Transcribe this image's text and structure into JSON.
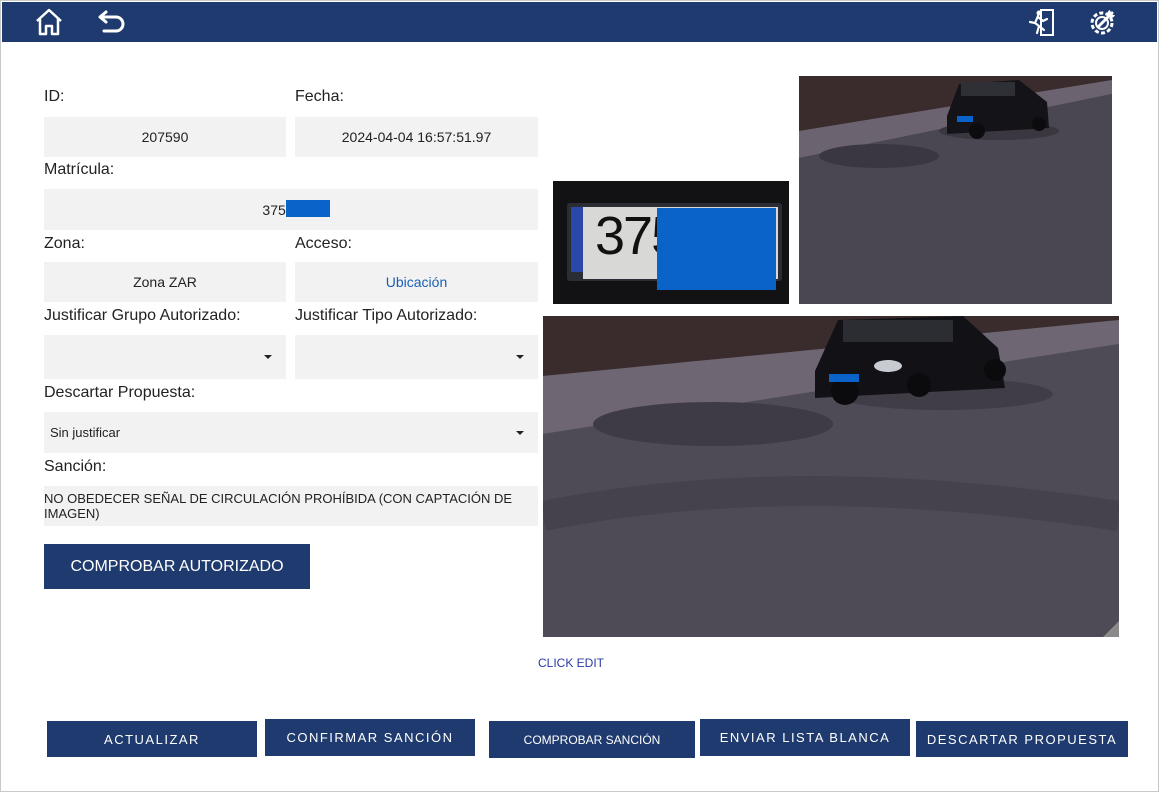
{
  "form": {
    "id_label": "ID:",
    "id_value": "207590",
    "fecha_label": "Fecha:",
    "fecha_value": "2024-04-04 16:57:51.97",
    "matricula_label": "Matrícula:",
    "matricula_value": "3755",
    "zona_label": "Zona:",
    "zona_value": "Zona ZAR",
    "acceso_label": "Acceso:",
    "acceso_value": "Ubicación",
    "grupo_label": "Justificar Grupo Autorizado:",
    "grupo_value": "",
    "tipo_label": "Justificar Tipo Autorizado:",
    "tipo_value": "",
    "descartar_label": "Descartar Propuesta:",
    "descartar_value": "Sin justificar",
    "sancion_label": "Sanción:",
    "sancion_value": "NO OBEDECER SEÑAL DE CIRCULACIÓN PROHÍBIDA (CON CAPTACIÓN DE IMAGEN)",
    "comprobar_autorizado": "COMPROBAR AUTORIZADO"
  },
  "images": {
    "plate_text": "375",
    "click_edit": "CLICK EDIT"
  },
  "actions": {
    "actualizar": "ACTUALIZAR",
    "confirmar": "CONFIRMAR SANCIÓN",
    "comprobar": "COMPROBAR SANCIÓN",
    "enviar": "ENVIAR LISTA BLANCA",
    "descartar": "DESCARTAR PROPUESTA"
  },
  "colors": {
    "header": "#1f3a6e",
    "button": "#1f3a6e",
    "field_bg": "#f2f2f2",
    "redaction": "#0a63c9",
    "link": "#1a5fb4"
  },
  "icons": {
    "home": "home-icon",
    "back": "back-arrow-icon",
    "logout": "exit-running-man-icon",
    "settings": "gear-wrench-icon"
  }
}
